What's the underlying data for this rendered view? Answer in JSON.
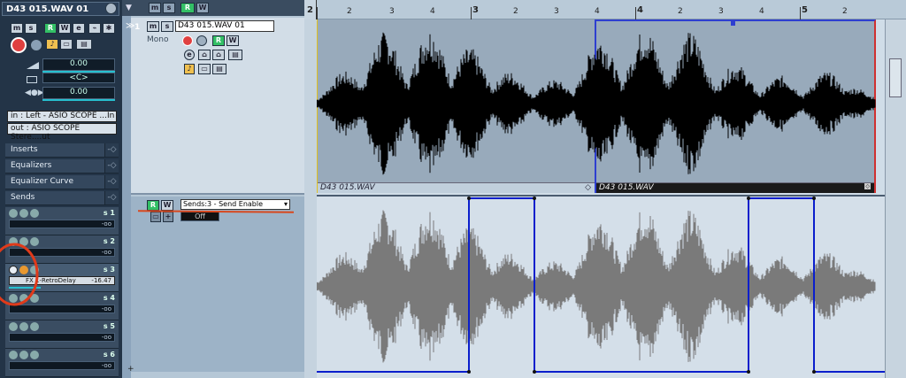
{
  "inspector": {
    "track_title": "D43 015.WAV 01",
    "volume": "0.00",
    "pan": "<C>",
    "delay": "0.00",
    "input": "in :  Left - ASIO SCOPE ...In",
    "output": "out :  ASIO SCOPE Stere....ut",
    "sections": [
      "Inserts",
      "Equalizers",
      "Equalizer Curve",
      "Sends"
    ],
    "sends": [
      {
        "label": "s 1",
        "value": "-oo",
        "name": ""
      },
      {
        "label": "s 2",
        "value": "-oo",
        "name": ""
      },
      {
        "label": "s 3",
        "value": "-16.47",
        "name": "FX 1-RetroDelay"
      },
      {
        "label": "s 4",
        "value": "-oo",
        "name": ""
      },
      {
        "label": "s 5",
        "value": "-oo",
        "name": ""
      },
      {
        "label": "s 6",
        "value": "-oo",
        "name": ""
      }
    ]
  },
  "tracklist": {
    "header_buttons": [
      "m",
      "s",
      "R",
      "W"
    ],
    "track_number": "1",
    "track_name": "D43 015.WAV 01",
    "mode": "Mono",
    "automation_param": "Sends:3 - Send Enable",
    "automation_value": "Off"
  },
  "ruler": {
    "bar_labels": [
      "2",
      "3",
      "4",
      "5"
    ],
    "beat_labels": [
      "2",
      "3",
      "4",
      "2",
      "3",
      "4",
      "2",
      "3",
      "4",
      "2"
    ]
  },
  "events": {
    "event1_label": "D43 015.WAV",
    "event2_label": "D43 015.WAV"
  },
  "colors": {
    "selection": "#2e3fd0",
    "automation": "#0a1ecc",
    "record": "#e04040",
    "read_green": "#33c066"
  }
}
